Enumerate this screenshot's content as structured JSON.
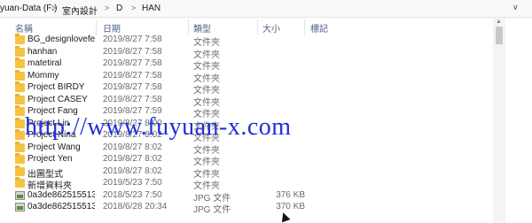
{
  "breadcrumb": {
    "drive": "yuan-Data (F:)",
    "folder1": "室內設計",
    "folder2": "D",
    "folder3": "HAN",
    "separator": ">"
  },
  "columns": {
    "name": "名稱",
    "date": "日期",
    "type": "類型",
    "size": "大小",
    "tags": "標記"
  },
  "rows": [
    {
      "name": "BG_designlovefes...",
      "date": "2019/8/27 7:58",
      "type": "文件夾",
      "size": "",
      "icon": "folder-icon"
    },
    {
      "name": "hanhan",
      "date": "2019/8/27 7:58",
      "type": "文件夾",
      "size": "",
      "icon": "folder-icon"
    },
    {
      "name": "matetiral",
      "date": "2019/8/27 7:58",
      "type": "文件夾",
      "size": "",
      "icon": "folder-icon"
    },
    {
      "name": "Mommy",
      "date": "2019/8/27 7:58",
      "type": "文件夾",
      "size": "",
      "icon": "folder-icon"
    },
    {
      "name": "Project BIRDY",
      "date": "2019/8/27 7:58",
      "type": "文件夾",
      "size": "",
      "icon": "folder-icon"
    },
    {
      "name": "Project CASEY",
      "date": "2019/8/27 7:58",
      "type": "文件夾",
      "size": "",
      "icon": "folder-icon"
    },
    {
      "name": "Project Fang",
      "date": "2019/8/27 7:59",
      "type": "文件夾",
      "size": "",
      "icon": "folder-icon"
    },
    {
      "name": "Project Lin",
      "date": "2019/8/27 8:00",
      "type": "文件夾",
      "size": "",
      "icon": "folder-icon"
    },
    {
      "name": "Project Nina",
      "date": "2019/8/27 8:02",
      "type": "文件夾",
      "size": "",
      "icon": "folder-icon"
    },
    {
      "name": "Project Wang",
      "date": "2019/8/27 8:02",
      "type": "文件夾",
      "size": "",
      "icon": "folder-icon"
    },
    {
      "name": "Project Yen",
      "date": "2019/8/27 8:02",
      "type": "文件夾",
      "size": "",
      "icon": "folder-icon"
    },
    {
      "name": "出圖型式",
      "date": "2019/8/27 8:02",
      "type": "文件夾",
      "size": "",
      "icon": "folder-icon"
    },
    {
      "name": "新增資料夾",
      "date": "2019/5/23 7:50",
      "type": "文件夾",
      "size": "",
      "icon": "folder-icon"
    },
    {
      "name": "0a3de862515513...",
      "date": "2018/5/23 7:50",
      "type": "JPG 文件",
      "size": "376 KB",
      "icon": "jpg-icon"
    },
    {
      "name": "0a3de862515513...",
      "date": "2018/6/28 20:34",
      "type": "JPG 文件",
      "size": "370 KB",
      "icon": "jpg-icon"
    }
  ],
  "watermark": "http://www.fuyuan-x.com",
  "colors": {
    "watermark": "#1f2fd9",
    "header_text": "#4d6082",
    "folder": "#f5c342"
  }
}
